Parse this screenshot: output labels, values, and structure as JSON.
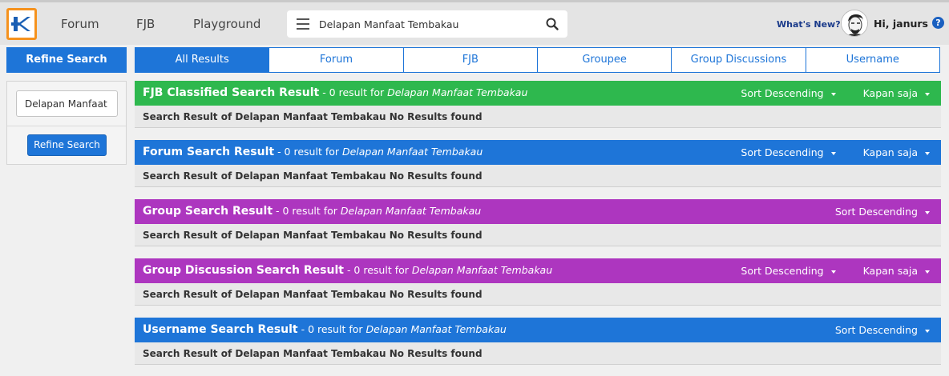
{
  "nav": {
    "links": [
      "Forum",
      "FJB",
      "Playground"
    ],
    "search_value": "Delapan Manfaat Tembakau",
    "whats_new": "What's New?",
    "greeting": "Hi, janurs",
    "help": "?"
  },
  "sidebar": {
    "header": "Refine Search",
    "input_value": "Delapan Manfaat",
    "button": "Refine Search"
  },
  "tabs": [
    "All Results",
    "Forum",
    "FJB",
    "Groupee",
    "Group Discussions",
    "Username"
  ],
  "sections": [
    {
      "title": "FJB Classified Search Result",
      "subtitle": " - 0 result for ",
      "query": "Delapan Manfaat Tembakau",
      "sort": "Sort Descending",
      "time": "Kapan saja",
      "body": "Search Result of Delapan Manfaat Tembakau No Results found"
    },
    {
      "title": "Forum Search Result",
      "subtitle": " - 0 result for ",
      "query": "Delapan Manfaat Tembakau",
      "sort": "Sort Descending",
      "time": "Kapan saja",
      "body": "Search Result of Delapan Manfaat Tembakau No Results found"
    },
    {
      "title": "Group Search Result",
      "subtitle": " - 0 result for ",
      "query": "Delapan Manfaat Tembakau",
      "sort": "Sort Descending",
      "body": "Search Result of Delapan Manfaat Tembakau No Results found"
    },
    {
      "title": "Group Discussion Search Result",
      "subtitle": " - 0 result for ",
      "query": "Delapan Manfaat Tembakau",
      "sort": "Sort Descending",
      "time": "Kapan saja",
      "body": "Search Result of Delapan Manfaat Tembakau No Results found"
    },
    {
      "title": "Username Search Result",
      "subtitle": " - 0 result for ",
      "query": "Delapan Manfaat Tembakau",
      "sort": "Sort Descending",
      "body": "Search Result of Delapan Manfaat Tembakau No Results found"
    }
  ],
  "colors": {
    "fjb": "#2eb84e",
    "forum": "#1e75d8",
    "group": "#ad36bf",
    "group_discussion": "#ad36bf",
    "username": "#1e75d8",
    "logo_border": "#f5921e"
  },
  "icons": {
    "logo": "kaskus-logo-icon",
    "menu": "hamburger-menu-icon",
    "search": "search-icon",
    "help": "help-icon",
    "caret": "caret-down-icon"
  }
}
